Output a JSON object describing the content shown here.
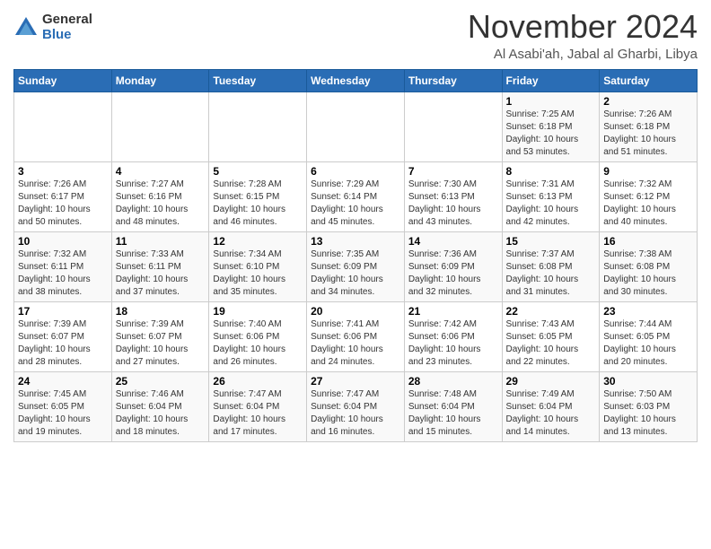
{
  "logo": {
    "general": "General",
    "blue": "Blue"
  },
  "header": {
    "month": "November 2024",
    "location": "Al Asabi'ah, Jabal al Gharbi, Libya"
  },
  "weekdays": [
    "Sunday",
    "Monday",
    "Tuesday",
    "Wednesday",
    "Thursday",
    "Friday",
    "Saturday"
  ],
  "weeks": [
    [
      {
        "day": "",
        "sunrise": "",
        "sunset": "",
        "daylight": ""
      },
      {
        "day": "",
        "sunrise": "",
        "sunset": "",
        "daylight": ""
      },
      {
        "day": "",
        "sunrise": "",
        "sunset": "",
        "daylight": ""
      },
      {
        "day": "",
        "sunrise": "",
        "sunset": "",
        "daylight": ""
      },
      {
        "day": "",
        "sunrise": "",
        "sunset": "",
        "daylight": ""
      },
      {
        "day": "1",
        "sunrise": "Sunrise: 7:25 AM",
        "sunset": "Sunset: 6:18 PM",
        "daylight": "Daylight: 10 hours and 53 minutes."
      },
      {
        "day": "2",
        "sunrise": "Sunrise: 7:26 AM",
        "sunset": "Sunset: 6:18 PM",
        "daylight": "Daylight: 10 hours and 51 minutes."
      }
    ],
    [
      {
        "day": "3",
        "sunrise": "Sunrise: 7:26 AM",
        "sunset": "Sunset: 6:17 PM",
        "daylight": "Daylight: 10 hours and 50 minutes."
      },
      {
        "day": "4",
        "sunrise": "Sunrise: 7:27 AM",
        "sunset": "Sunset: 6:16 PM",
        "daylight": "Daylight: 10 hours and 48 minutes."
      },
      {
        "day": "5",
        "sunrise": "Sunrise: 7:28 AM",
        "sunset": "Sunset: 6:15 PM",
        "daylight": "Daylight: 10 hours and 46 minutes."
      },
      {
        "day": "6",
        "sunrise": "Sunrise: 7:29 AM",
        "sunset": "Sunset: 6:14 PM",
        "daylight": "Daylight: 10 hours and 45 minutes."
      },
      {
        "day": "7",
        "sunrise": "Sunrise: 7:30 AM",
        "sunset": "Sunset: 6:13 PM",
        "daylight": "Daylight: 10 hours and 43 minutes."
      },
      {
        "day": "8",
        "sunrise": "Sunrise: 7:31 AM",
        "sunset": "Sunset: 6:13 PM",
        "daylight": "Daylight: 10 hours and 42 minutes."
      },
      {
        "day": "9",
        "sunrise": "Sunrise: 7:32 AM",
        "sunset": "Sunset: 6:12 PM",
        "daylight": "Daylight: 10 hours and 40 minutes."
      }
    ],
    [
      {
        "day": "10",
        "sunrise": "Sunrise: 7:32 AM",
        "sunset": "Sunset: 6:11 PM",
        "daylight": "Daylight: 10 hours and 38 minutes."
      },
      {
        "day": "11",
        "sunrise": "Sunrise: 7:33 AM",
        "sunset": "Sunset: 6:11 PM",
        "daylight": "Daylight: 10 hours and 37 minutes."
      },
      {
        "day": "12",
        "sunrise": "Sunrise: 7:34 AM",
        "sunset": "Sunset: 6:10 PM",
        "daylight": "Daylight: 10 hours and 35 minutes."
      },
      {
        "day": "13",
        "sunrise": "Sunrise: 7:35 AM",
        "sunset": "Sunset: 6:09 PM",
        "daylight": "Daylight: 10 hours and 34 minutes."
      },
      {
        "day": "14",
        "sunrise": "Sunrise: 7:36 AM",
        "sunset": "Sunset: 6:09 PM",
        "daylight": "Daylight: 10 hours and 32 minutes."
      },
      {
        "day": "15",
        "sunrise": "Sunrise: 7:37 AM",
        "sunset": "Sunset: 6:08 PM",
        "daylight": "Daylight: 10 hours and 31 minutes."
      },
      {
        "day": "16",
        "sunrise": "Sunrise: 7:38 AM",
        "sunset": "Sunset: 6:08 PM",
        "daylight": "Daylight: 10 hours and 30 minutes."
      }
    ],
    [
      {
        "day": "17",
        "sunrise": "Sunrise: 7:39 AM",
        "sunset": "Sunset: 6:07 PM",
        "daylight": "Daylight: 10 hours and 28 minutes."
      },
      {
        "day": "18",
        "sunrise": "Sunrise: 7:39 AM",
        "sunset": "Sunset: 6:07 PM",
        "daylight": "Daylight: 10 hours and 27 minutes."
      },
      {
        "day": "19",
        "sunrise": "Sunrise: 7:40 AM",
        "sunset": "Sunset: 6:06 PM",
        "daylight": "Daylight: 10 hours and 26 minutes."
      },
      {
        "day": "20",
        "sunrise": "Sunrise: 7:41 AM",
        "sunset": "Sunset: 6:06 PM",
        "daylight": "Daylight: 10 hours and 24 minutes."
      },
      {
        "day": "21",
        "sunrise": "Sunrise: 7:42 AM",
        "sunset": "Sunset: 6:06 PM",
        "daylight": "Daylight: 10 hours and 23 minutes."
      },
      {
        "day": "22",
        "sunrise": "Sunrise: 7:43 AM",
        "sunset": "Sunset: 6:05 PM",
        "daylight": "Daylight: 10 hours and 22 minutes."
      },
      {
        "day": "23",
        "sunrise": "Sunrise: 7:44 AM",
        "sunset": "Sunset: 6:05 PM",
        "daylight": "Daylight: 10 hours and 20 minutes."
      }
    ],
    [
      {
        "day": "24",
        "sunrise": "Sunrise: 7:45 AM",
        "sunset": "Sunset: 6:05 PM",
        "daylight": "Daylight: 10 hours and 19 minutes."
      },
      {
        "day": "25",
        "sunrise": "Sunrise: 7:46 AM",
        "sunset": "Sunset: 6:04 PM",
        "daylight": "Daylight: 10 hours and 18 minutes."
      },
      {
        "day": "26",
        "sunrise": "Sunrise: 7:47 AM",
        "sunset": "Sunset: 6:04 PM",
        "daylight": "Daylight: 10 hours and 17 minutes."
      },
      {
        "day": "27",
        "sunrise": "Sunrise: 7:47 AM",
        "sunset": "Sunset: 6:04 PM",
        "daylight": "Daylight: 10 hours and 16 minutes."
      },
      {
        "day": "28",
        "sunrise": "Sunrise: 7:48 AM",
        "sunset": "Sunset: 6:04 PM",
        "daylight": "Daylight: 10 hours and 15 minutes."
      },
      {
        "day": "29",
        "sunrise": "Sunrise: 7:49 AM",
        "sunset": "Sunset: 6:04 PM",
        "daylight": "Daylight: 10 hours and 14 minutes."
      },
      {
        "day": "30",
        "sunrise": "Sunrise: 7:50 AM",
        "sunset": "Sunset: 6:03 PM",
        "daylight": "Daylight: 10 hours and 13 minutes."
      }
    ]
  ]
}
